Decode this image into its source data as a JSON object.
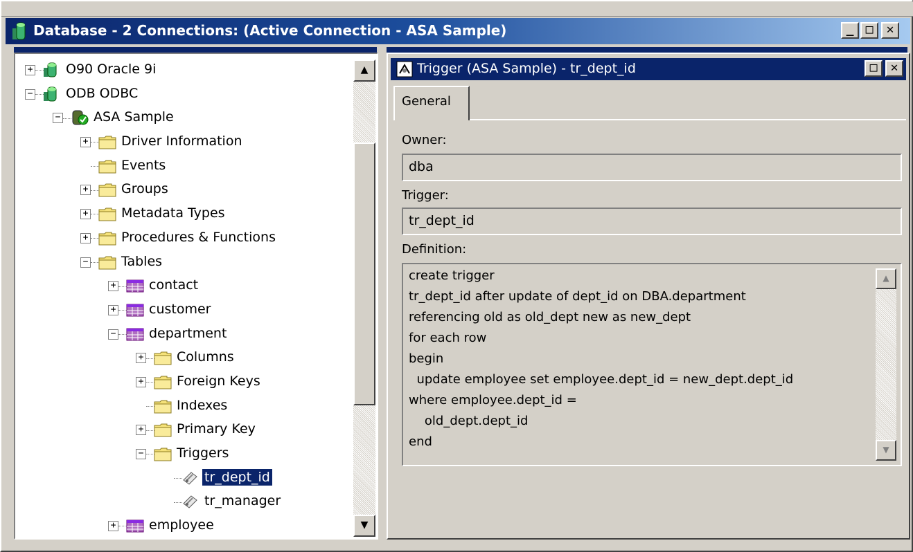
{
  "window": {
    "title": "Database - 2 Connections: (Active Connection - ASA Sample)",
    "minimize": "_",
    "maximize": "□",
    "close": "✕"
  },
  "tree": {
    "nodes": [
      {
        "label": "O90 Oracle 9i",
        "icon": "database-icon",
        "expander": "+"
      },
      {
        "label": "ODB ODBC",
        "icon": "database-icon",
        "expander": "−"
      },
      {
        "label": "ASA Sample",
        "icon": "connected-database-icon",
        "expander": "−"
      },
      {
        "label": "Driver Information",
        "icon": "folder-icon",
        "expander": "+"
      },
      {
        "label": "Events",
        "icon": "folder-icon",
        "expander": ""
      },
      {
        "label": "Groups",
        "icon": "folder-icon",
        "expander": "+"
      },
      {
        "label": "Metadata Types",
        "icon": "folder-icon",
        "expander": "+"
      },
      {
        "label": "Procedures & Functions",
        "icon": "folder-icon",
        "expander": "+"
      },
      {
        "label": "Tables",
        "icon": "folder-icon",
        "expander": "−"
      },
      {
        "label": "contact",
        "icon": "table-icon",
        "expander": "+"
      },
      {
        "label": "customer",
        "icon": "table-icon",
        "expander": "+"
      },
      {
        "label": "department",
        "icon": "table-icon",
        "expander": "−"
      },
      {
        "label": "Columns",
        "icon": "folder-icon",
        "expander": "+"
      },
      {
        "label": "Foreign Keys",
        "icon": "folder-icon",
        "expander": "+"
      },
      {
        "label": "Indexes",
        "icon": "folder-icon",
        "expander": ""
      },
      {
        "label": "Primary Key",
        "icon": "folder-icon",
        "expander": "+"
      },
      {
        "label": "Triggers",
        "icon": "folder-icon",
        "expander": "−"
      },
      {
        "label": "tr_dept_id",
        "icon": "trigger-icon",
        "expander": ""
      },
      {
        "label": "tr_manager",
        "icon": "trigger-icon",
        "expander": ""
      },
      {
        "label": "employee",
        "icon": "table-icon",
        "expander": "+"
      }
    ]
  },
  "child_window": {
    "title": "Trigger (ASA Sample) - tr_dept_id",
    "tab": "General",
    "owner_label": "Owner:",
    "owner_value": "dba",
    "trigger_label": "Trigger:",
    "trigger_value": "tr_dept_id",
    "definition_label": "Definition:",
    "definition_lines": [
      "create trigger",
      "tr_dept_id after update of dept_id on DBA.department",
      "referencing old as old_dept new as new_dept",
      "for each row",
      "begin",
      "  update employee set employee.dept_id = new_dept.dept_id",
      "where employee.dept_id =",
      "    old_dept.dept_id",
      "end"
    ]
  },
  "colors": {
    "title_active": "#0a246a",
    "face": "#d4d0c8",
    "folder": "#f5e27a",
    "table": "#8a2be2"
  }
}
